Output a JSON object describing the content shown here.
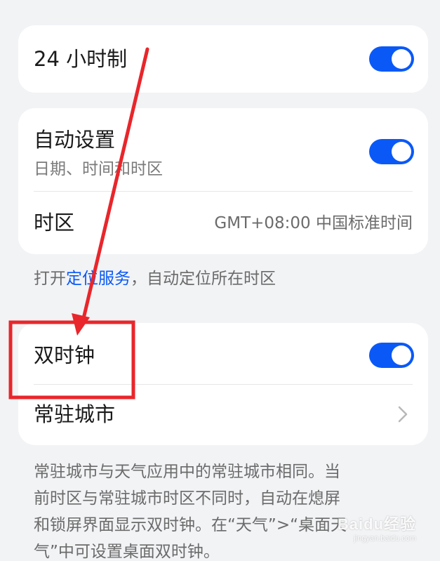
{
  "settings": {
    "clock24": {
      "label": "24 小时制",
      "enabled": true
    },
    "auto": {
      "label": "自动设置",
      "sublabel": "日期、时间和时区",
      "enabled": true
    },
    "timezone": {
      "label": "时区",
      "value": "GMT+08:00 中国标准时间"
    },
    "location_hint": {
      "prefix": "打开",
      "link": "定位服务",
      "suffix": "，自动定位所在时区"
    },
    "dual_clock": {
      "label": "双时钟",
      "enabled": true
    },
    "home_city": {
      "label": "常驻城市"
    },
    "description": {
      "lines": [
        "常驻城市与天气应用中的常驻城市相同。当",
        "前时区与常驻城市时区不同时，自动在熄屏",
        "和锁屏界面显示双时钟。在“天气”>“桌面天",
        "气”中可设置桌面双时钟。"
      ]
    }
  },
  "annotation": {
    "arrow_color": "#e8262b",
    "box_color": "#e8262b"
  },
  "watermark": {
    "main": "Baidu经验",
    "sub": "jingyan.baidu.com"
  },
  "colors": {
    "accent": "#0a59f7",
    "background": "#f2f3f5"
  }
}
